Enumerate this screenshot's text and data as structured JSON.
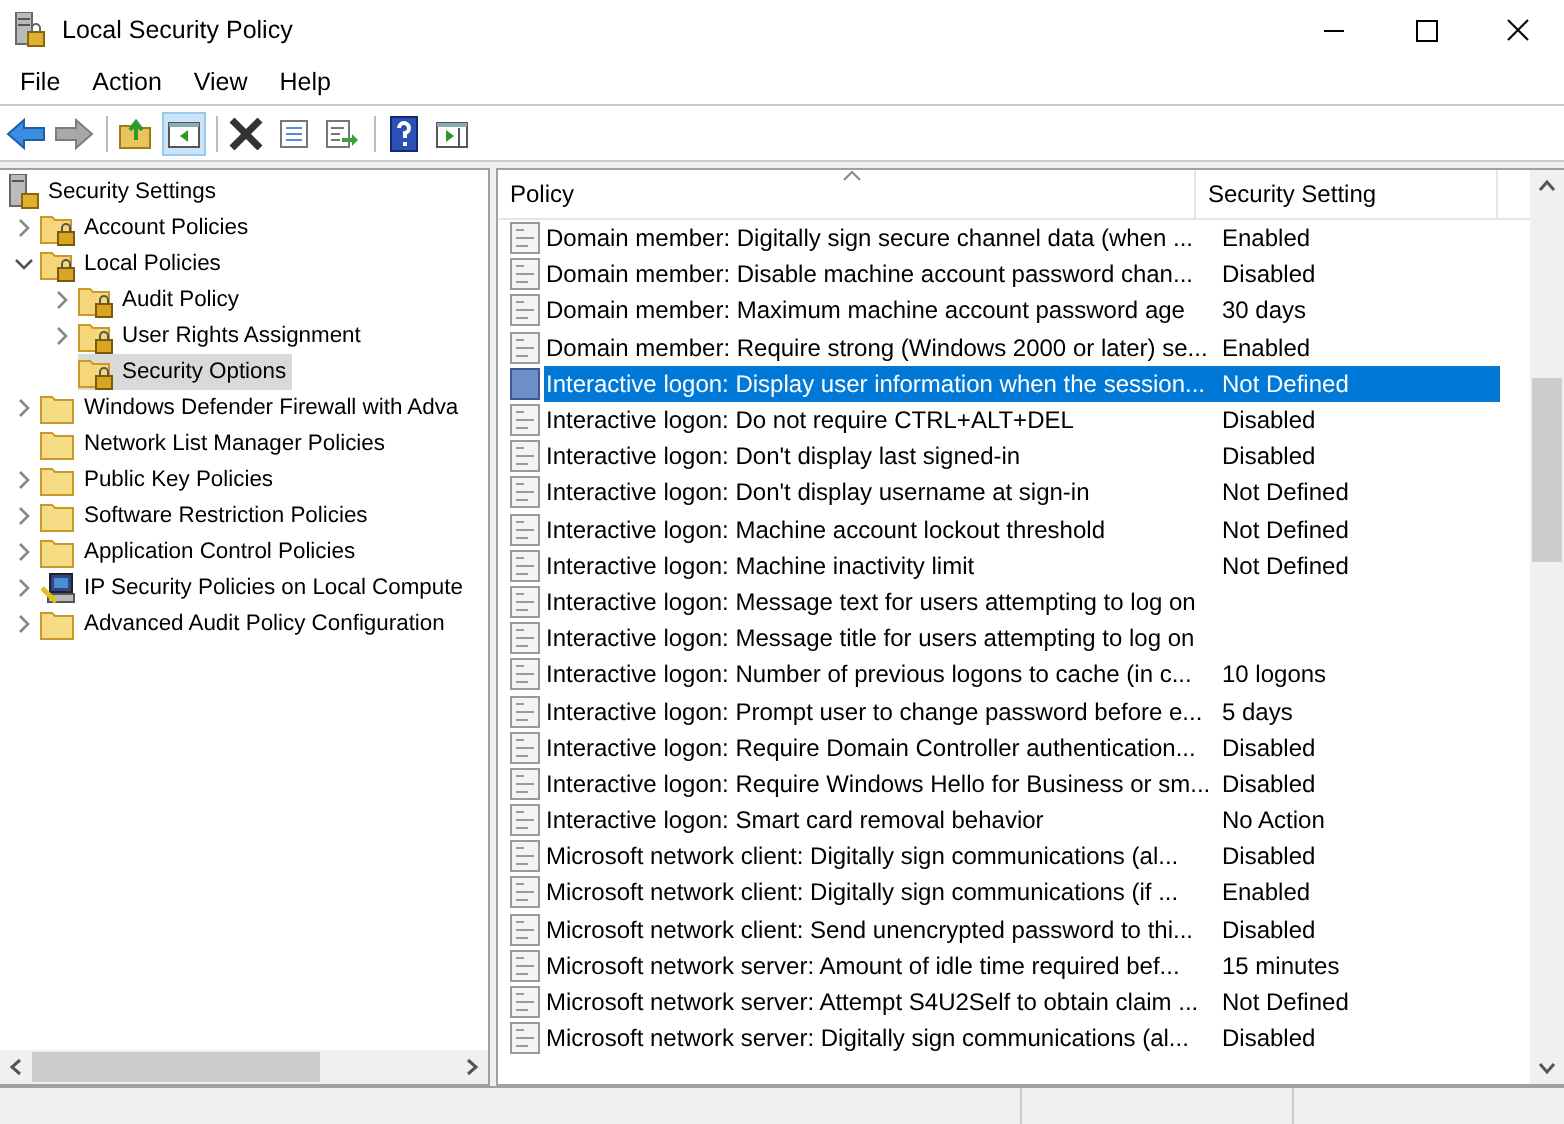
{
  "window": {
    "title": "Local Security Policy"
  },
  "menu": [
    "File",
    "Action",
    "View",
    "Help"
  ],
  "toolbar": [
    {
      "kind": "back",
      "pressed": false,
      "disabled": false
    },
    {
      "kind": "forward",
      "pressed": false,
      "disabled": true
    },
    {
      "kind": "up",
      "pressed": false,
      "disabled": false
    },
    {
      "kind": "tree-toggle",
      "pressed": true,
      "disabled": false
    },
    {
      "kind": "delete",
      "pressed": false,
      "disabled": false
    },
    {
      "kind": "properties",
      "pressed": false,
      "disabled": false
    },
    {
      "kind": "export",
      "pressed": false,
      "disabled": false
    },
    {
      "kind": "help",
      "pressed": false,
      "disabled": false
    },
    {
      "kind": "action-pane",
      "pressed": false,
      "disabled": false
    }
  ],
  "tree": [
    {
      "label": "Security Settings",
      "kind": "root",
      "selected": false,
      "children": [
        {
          "label": "Account Policies",
          "kind": "secured-folder",
          "expanded": false,
          "selected": false
        },
        {
          "label": "Local Policies",
          "kind": "secured-folder",
          "expanded": true,
          "selected": false,
          "children": [
            {
              "label": "Audit Policy",
              "kind": "secured-folder",
              "expanded": false,
              "selected": false
            },
            {
              "label": "User Rights Assignment",
              "kind": "secured-folder",
              "expanded": false,
              "selected": false
            },
            {
              "label": "Security Options",
              "kind": "secured-folder",
              "selected": true
            }
          ]
        },
        {
          "label": "Windows Defender Firewall with Adva",
          "kind": "folder",
          "expanded": false,
          "selected": false
        },
        {
          "label": "Network List Manager Policies",
          "kind": "folder",
          "selected": false
        },
        {
          "label": "Public Key Policies",
          "kind": "folder",
          "expanded": false,
          "selected": false
        },
        {
          "label": "Software Restriction Policies",
          "kind": "folder",
          "expanded": false,
          "selected": false
        },
        {
          "label": "Application Control Policies",
          "kind": "folder",
          "expanded": false,
          "selected": false
        },
        {
          "label": "IP Security Policies on Local Compute",
          "kind": "network-policy",
          "expanded": false,
          "selected": false
        },
        {
          "label": "Advanced Audit Policy Configuration",
          "kind": "folder",
          "expanded": false,
          "selected": false
        }
      ]
    }
  ],
  "table": {
    "columns": [
      "Policy",
      "Security Setting"
    ],
    "rows": [
      {
        "policy": "Domain member: Digitally sign secure channel data (when ...",
        "setting": "Enabled",
        "selected": false
      },
      {
        "policy": "Domain member: Disable machine account password chan...",
        "setting": "Disabled",
        "selected": false
      },
      {
        "policy": "Domain member: Maximum machine account password age",
        "setting": "30 days",
        "selected": false
      },
      {
        "policy": "Domain member: Require strong (Windows 2000 or later) se...",
        "setting": "Enabled",
        "selected": false
      },
      {
        "policy": "Interactive logon: Display user information when the session...",
        "setting": "Not Defined",
        "selected": true
      },
      {
        "policy": "Interactive logon: Do not require CTRL+ALT+DEL",
        "setting": "Disabled",
        "selected": false
      },
      {
        "policy": "Interactive logon: Don't display last signed-in",
        "setting": "Disabled",
        "selected": false
      },
      {
        "policy": "Interactive logon: Don't display username at sign-in",
        "setting": "Not Defined",
        "selected": false
      },
      {
        "policy": "Interactive logon: Machine account lockout threshold",
        "setting": "Not Defined",
        "selected": false
      },
      {
        "policy": "Interactive logon: Machine inactivity limit",
        "setting": "Not Defined",
        "selected": false
      },
      {
        "policy": "Interactive logon: Message text for users attempting to log on",
        "selected": false
      },
      {
        "policy": "Interactive logon: Message title for users attempting to log on",
        "selected": false
      },
      {
        "policy": "Interactive logon: Number of previous logons to cache (in c...",
        "setting": "10 logons",
        "selected": false
      },
      {
        "policy": "Interactive logon: Prompt user to change password before e...",
        "setting": "5 days",
        "selected": false
      },
      {
        "policy": "Interactive logon: Require Domain Controller authentication...",
        "setting": "Disabled",
        "selected": false
      },
      {
        "policy": "Interactive logon: Require Windows Hello for Business or sm...",
        "setting": "Disabled",
        "selected": false
      },
      {
        "policy": "Interactive logon: Smart card removal behavior",
        "setting": "No Action",
        "selected": false
      },
      {
        "policy": "Microsoft network client: Digitally sign communications (al...",
        "setting": "Disabled",
        "selected": false
      },
      {
        "policy": "Microsoft network client: Digitally sign communications (if ...",
        "setting": "Enabled",
        "selected": false
      },
      {
        "policy": "Microsoft network client: Send unencrypted password to thi...",
        "setting": "Disabled",
        "selected": false
      },
      {
        "policy": "Microsoft network server: Amount of idle time required bef...",
        "setting": "15 minutes",
        "selected": false
      },
      {
        "policy": "Microsoft network server: Attempt S4U2Self to obtain claim ...",
        "setting": "Not Defined",
        "selected": false
      },
      {
        "policy": "Microsoft network server: Digitally sign communications (al...",
        "setting": "Disabled",
        "selected": false
      }
    ]
  }
}
